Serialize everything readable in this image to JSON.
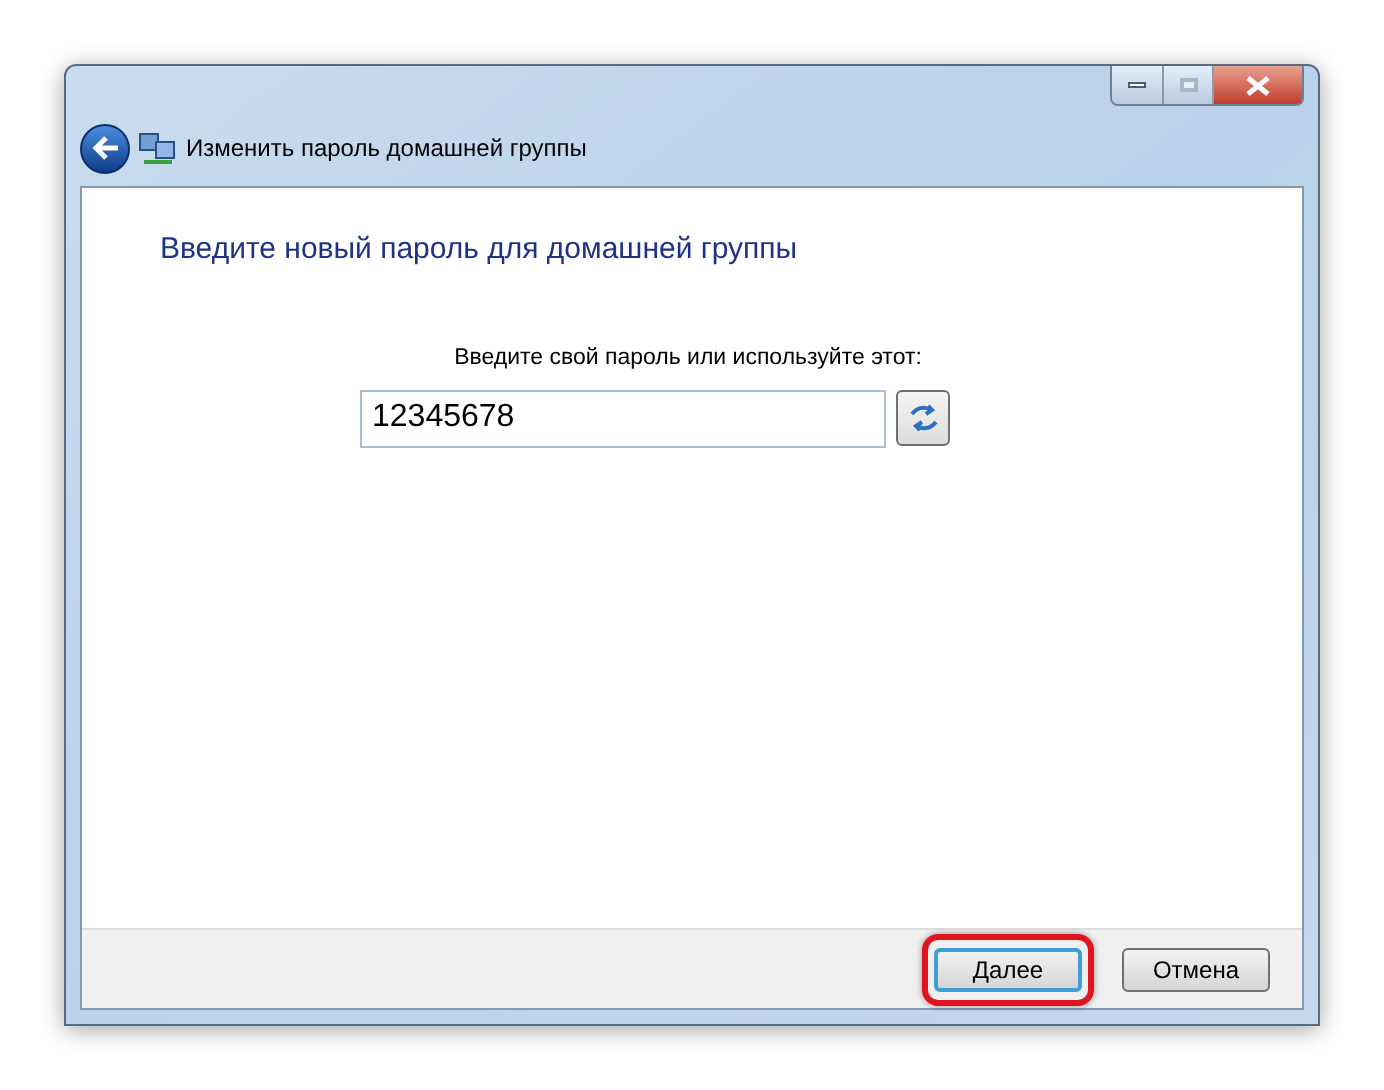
{
  "window": {
    "title": "Изменить пароль домашней группы"
  },
  "heading": "Введите новый пароль для домашней группы",
  "password": {
    "label": "Введите свой пароль или используйте этот:",
    "value": "12345678"
  },
  "buttons": [
    {
      "label": "Далее",
      "default": true,
      "highlighted": true
    },
    {
      "label": "Отмена",
      "default": false,
      "highlighted": false
    }
  ]
}
